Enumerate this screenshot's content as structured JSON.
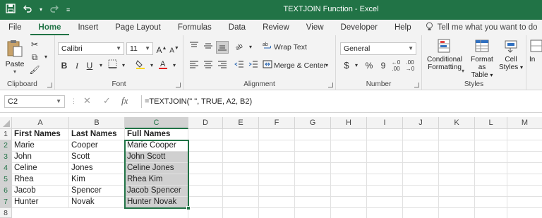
{
  "window": {
    "title": "TEXTJOIN Function  -  Excel"
  },
  "qat": {
    "icons": [
      "save-icon",
      "undo-icon",
      "redo-icon",
      "customize-icon"
    ]
  },
  "tabs": [
    "File",
    "Home",
    "Insert",
    "Page Layout",
    "Formulas",
    "Data",
    "Review",
    "View",
    "Developer",
    "Help"
  ],
  "tell_me": "Tell me what you want to do",
  "ribbon": {
    "clipboard": {
      "paste": "Paste",
      "label": "Clipboard"
    },
    "font": {
      "name": "Calibri",
      "size": "11",
      "label": "Font",
      "bold": "B",
      "italic": "I",
      "underline": "U"
    },
    "alignment": {
      "wrap_text": "Wrap Text",
      "merge_center": "Merge & Center",
      "label": "Alignment"
    },
    "number": {
      "format": "General",
      "label": "Number",
      "currency": "$",
      "percent": "%",
      "comma": "9"
    },
    "styles": {
      "conditional_1": "Conditional",
      "conditional_2": "Formatting",
      "format_table_1": "Format as",
      "format_table_2": "Table",
      "cell_styles_1": "Cell",
      "cell_styles_2": "Styles",
      "label": "Styles"
    },
    "cells": {
      "insert": "In"
    }
  },
  "formula_bar": {
    "name_box": "C2",
    "cancel": "✕",
    "enter": "✓",
    "fx": "fx",
    "formula": "=TEXTJOIN(\" \", TRUE, A2, B2)"
  },
  "sheet": {
    "columns": [
      "A",
      "B",
      "C",
      "D",
      "E",
      "F",
      "G",
      "H",
      "I",
      "J",
      "K",
      "L",
      "M"
    ],
    "rows": [
      "1",
      "2",
      "3",
      "4",
      "5",
      "6",
      "7",
      "8"
    ],
    "headers": {
      "a": "First Names",
      "b": "Last Names",
      "c": "Full Names"
    },
    "data": [
      {
        "a": "Marie",
        "b": "Cooper",
        "c": "Marie Cooper"
      },
      {
        "a": "John",
        "b": "Scott",
        "c": "John Scott"
      },
      {
        "a": "Celine",
        "b": "Jones",
        "c": "Celine Jones"
      },
      {
        "a": "Rhea",
        "b": "Kim",
        "c": "Rhea Kim"
      },
      {
        "a": "Jacob",
        "b": "Spencer",
        "c": "Jacob Spencer"
      },
      {
        "a": "Hunter",
        "b": "Novak",
        "c": "Hunter Novak"
      }
    ]
  },
  "colors": {
    "accent": "#217346"
  }
}
